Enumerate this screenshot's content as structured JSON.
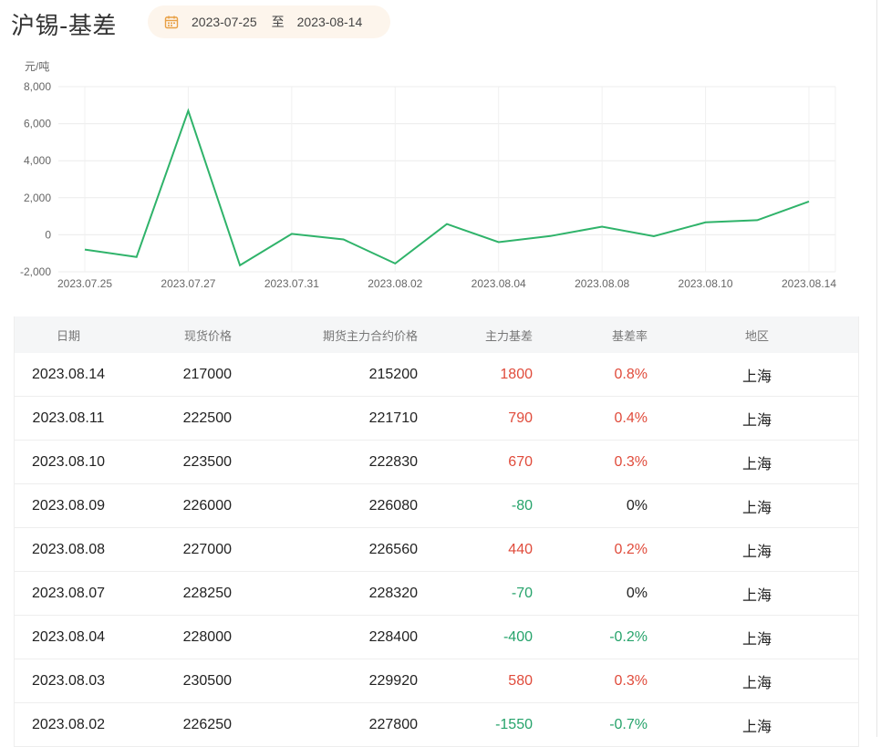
{
  "header": {
    "title": "沪锡-基差",
    "date_start": "2023-07-25",
    "date_separator": "至",
    "date_end": "2023-08-14"
  },
  "colors": {
    "line": "#2fb36a",
    "positive": "#e04b3b",
    "negative": "#26a36b",
    "date_bg": "#fdf5ec",
    "calendar_icon": "#e8a045"
  },
  "chart_data": {
    "type": "line",
    "ylabel": "元/吨",
    "ylim": [
      -2000,
      8000
    ],
    "yticks": [
      "8,000",
      "6,000",
      "4,000",
      "2,000",
      "0",
      "-2,000"
    ],
    "ytick_values": [
      8000,
      6000,
      4000,
      2000,
      0,
      -2000
    ],
    "xtick_labels": [
      "2023.07.25",
      "2023.07.27",
      "2023.07.31",
      "2023.08.02",
      "2023.08.04",
      "2023.08.08",
      "2023.08.10",
      "2023.08.14"
    ],
    "xtick_indices": [
      0,
      2,
      4,
      6,
      8,
      10,
      12,
      14
    ],
    "grid": true,
    "series": [
      {
        "x": [
          "2023.07.25",
          "2023.07.26",
          "2023.07.27",
          "2023.07.28",
          "2023.07.31",
          "2023.08.01",
          "2023.08.02",
          "2023.08.03",
          "2023.08.04",
          "2023.08.07",
          "2023.08.08",
          "2023.08.09",
          "2023.08.10",
          "2023.08.11",
          "2023.08.14"
        ],
        "values": [
          -800,
          -1200,
          6700,
          -1650,
          50,
          -250,
          -1550,
          580,
          -400,
          -70,
          440,
          -80,
          670,
          790,
          1800
        ]
      }
    ]
  },
  "table": {
    "headers": {
      "date": "日期",
      "spot": "现货价格",
      "futures": "期货主力合约价格",
      "basis": "主力基差",
      "rate": "基差率",
      "region": "地区"
    },
    "rows": [
      {
        "date": "2023.08.14",
        "spot": "217000",
        "futures": "215200",
        "basis": "1800",
        "rate": "0.8%",
        "region": "上海",
        "sign": "pos"
      },
      {
        "date": "2023.08.11",
        "spot": "222500",
        "futures": "221710",
        "basis": "790",
        "rate": "0.4%",
        "region": "上海",
        "sign": "pos"
      },
      {
        "date": "2023.08.10",
        "spot": "223500",
        "futures": "222830",
        "basis": "670",
        "rate": "0.3%",
        "region": "上海",
        "sign": "pos"
      },
      {
        "date": "2023.08.09",
        "spot": "226000",
        "futures": "226080",
        "basis": "-80",
        "rate": "0%",
        "region": "上海",
        "sign": "neg",
        "rate_sign": "zero"
      },
      {
        "date": "2023.08.08",
        "spot": "227000",
        "futures": "226560",
        "basis": "440",
        "rate": "0.2%",
        "region": "上海",
        "sign": "pos"
      },
      {
        "date": "2023.08.07",
        "spot": "228250",
        "futures": "228320",
        "basis": "-70",
        "rate": "0%",
        "region": "上海",
        "sign": "neg",
        "rate_sign": "zero"
      },
      {
        "date": "2023.08.04",
        "spot": "228000",
        "futures": "228400",
        "basis": "-400",
        "rate": "-0.2%",
        "region": "上海",
        "sign": "neg"
      },
      {
        "date": "2023.08.03",
        "spot": "230500",
        "futures": "229920",
        "basis": "580",
        "rate": "0.3%",
        "region": "上海",
        "sign": "pos"
      },
      {
        "date": "2023.08.02",
        "spot": "226250",
        "futures": "227800",
        "basis": "-1550",
        "rate": "-0.7%",
        "region": "上海",
        "sign": "neg"
      }
    ]
  }
}
